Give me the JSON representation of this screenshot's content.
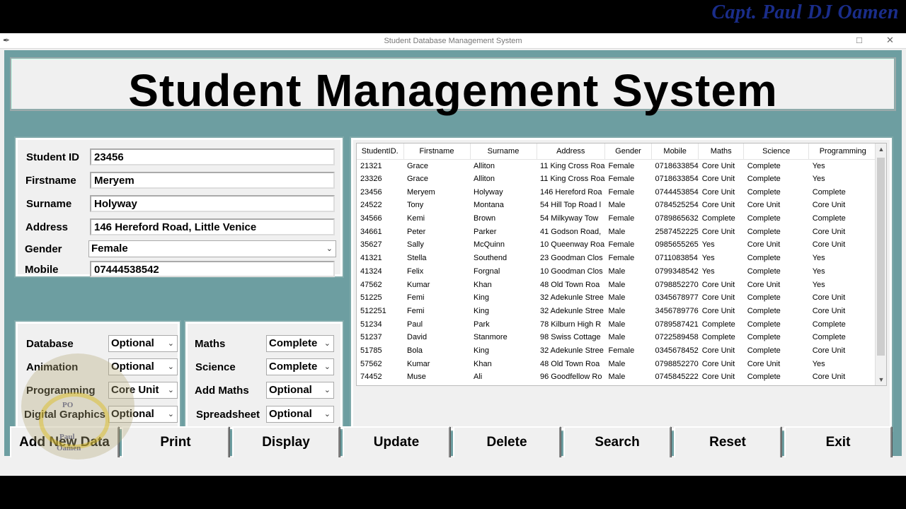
{
  "window": {
    "title": "Student Database Management System",
    "watermark": "Capt. Paul DJ Oamen",
    "logo_top": "PO",
    "logo_name1": "Paul",
    "logo_name2": "Oamen"
  },
  "header": {
    "title": "Student Management System"
  },
  "form": {
    "student_id_label": "Student ID",
    "student_id": "23456",
    "firstname_label": "Firstname",
    "firstname": "Meryem",
    "surname_label": "Surname",
    "surname": "Holyway",
    "address_label": "Address",
    "address": "146 Hereford Road, Little Venice",
    "gender_label": "Gender",
    "gender": "Female",
    "mobile_label": "Mobile",
    "mobile": "07444538542"
  },
  "subjects_left": [
    {
      "label": "Database",
      "value": "Optional"
    },
    {
      "label": "Animation",
      "value": "Optional"
    },
    {
      "label": "Programming",
      "value": "Core Unit"
    },
    {
      "label": "Digital Graphics",
      "value": "Optional"
    }
  ],
  "subjects_right": [
    {
      "label": "Maths",
      "value": "Complete"
    },
    {
      "label": "Science",
      "value": "Complete"
    },
    {
      "label": "Add Maths",
      "value": "Optional"
    },
    {
      "label": "Spreadsheet",
      "value": "Optional"
    }
  ],
  "table": {
    "columns": [
      "StudentID.",
      "Firstname",
      "Surname",
      "Address",
      "Gender",
      "Mobile",
      "Maths",
      "Science",
      "Programming"
    ],
    "rows": [
      [
        "21321",
        "Grace",
        "Alliton",
        "11 King Cross Roa",
        "Female",
        "0718633854",
        "Core Unit",
        "Complete",
        "Yes"
      ],
      [
        "23326",
        "Grace",
        "Alliton",
        "11 King Cross Roa",
        "Female",
        "0718633854",
        "Core Unit",
        "Complete",
        "Yes"
      ],
      [
        "23456",
        "Meryem",
        "Holyway",
        "146 Hereford Roa",
        "Female",
        "0744453854",
        "Core Unit",
        "Complete",
        "Complete"
      ],
      [
        "24522",
        "Tony",
        "Montana",
        "54 Hill Top Road l",
        "Male",
        "0784525254",
        "Core Unit",
        "Core Unit",
        "Core Unit"
      ],
      [
        "34566",
        "Kemi",
        "Brown",
        "54 Milkyway Tow",
        "Female",
        "0789865632",
        "Complete",
        "Complete",
        "Complete"
      ],
      [
        "34661",
        "Peter",
        "Parker",
        "41 Godson Road,",
        "Male",
        "2587452225",
        "Core Unit",
        "Complete",
        "Core Unit"
      ],
      [
        "35627",
        "Sally",
        "McQuinn",
        "10 Queenway Roa",
        "Female",
        "0985655265",
        "Yes",
        "Core Unit",
        "Core Unit"
      ],
      [
        "41321",
        "Stella",
        "Southend",
        "23 Goodman Clos",
        "Female",
        "0711083854",
        "Yes",
        "Complete",
        "Yes"
      ],
      [
        "41324",
        "Felix",
        "Forgnal",
        "10 Goodman Clos",
        "Male",
        "0799348542",
        "Yes",
        "Complete",
        "Yes"
      ],
      [
        "47562",
        "Kumar",
        "Khan",
        "48 Old Town Roa",
        "Male",
        "0798852270",
        "Core Unit",
        "Core Unit",
        "Yes"
      ],
      [
        "51225",
        "Femi",
        "King",
        "32 Adekunle Stree",
        "Male",
        "0345678977",
        "Core Unit",
        "Complete",
        "Core Unit"
      ],
      [
        "512251",
        "Femi",
        "King",
        "32 Adekunle Stree",
        "Male",
        "3456789776",
        "Core Unit",
        "Complete",
        "Core Unit"
      ],
      [
        "51234",
        "Paul",
        "Park",
        "78 Kilburn High R",
        "Male",
        "0789587421",
        "Complete",
        "Complete",
        "Complete"
      ],
      [
        "51237",
        "David",
        "Stanmore",
        "98 Swiss Cottage",
        "Male",
        "0722589458",
        "Complete",
        "Complete",
        "Complete"
      ],
      [
        "51785",
        "Bola",
        "King",
        "32 Adekunle Stree",
        "Female",
        "0345678452",
        "Core Unit",
        "Complete",
        "Core Unit"
      ],
      [
        "57562",
        "Kumar",
        "Khan",
        "48 Old Town Roa",
        "Male",
        "0798852270",
        "Core Unit",
        "Core Unit",
        "Yes"
      ],
      [
        "74452",
        "Muse",
        "Ali",
        "96 Goodfellow Ro",
        "Male",
        "0745845222",
        "Core Unit",
        "Complete",
        "Core Unit"
      ]
    ]
  },
  "buttons": [
    "Add New Data",
    "Print",
    "Display",
    "Update",
    "Delete",
    "Search",
    "Reset",
    "Exit"
  ]
}
